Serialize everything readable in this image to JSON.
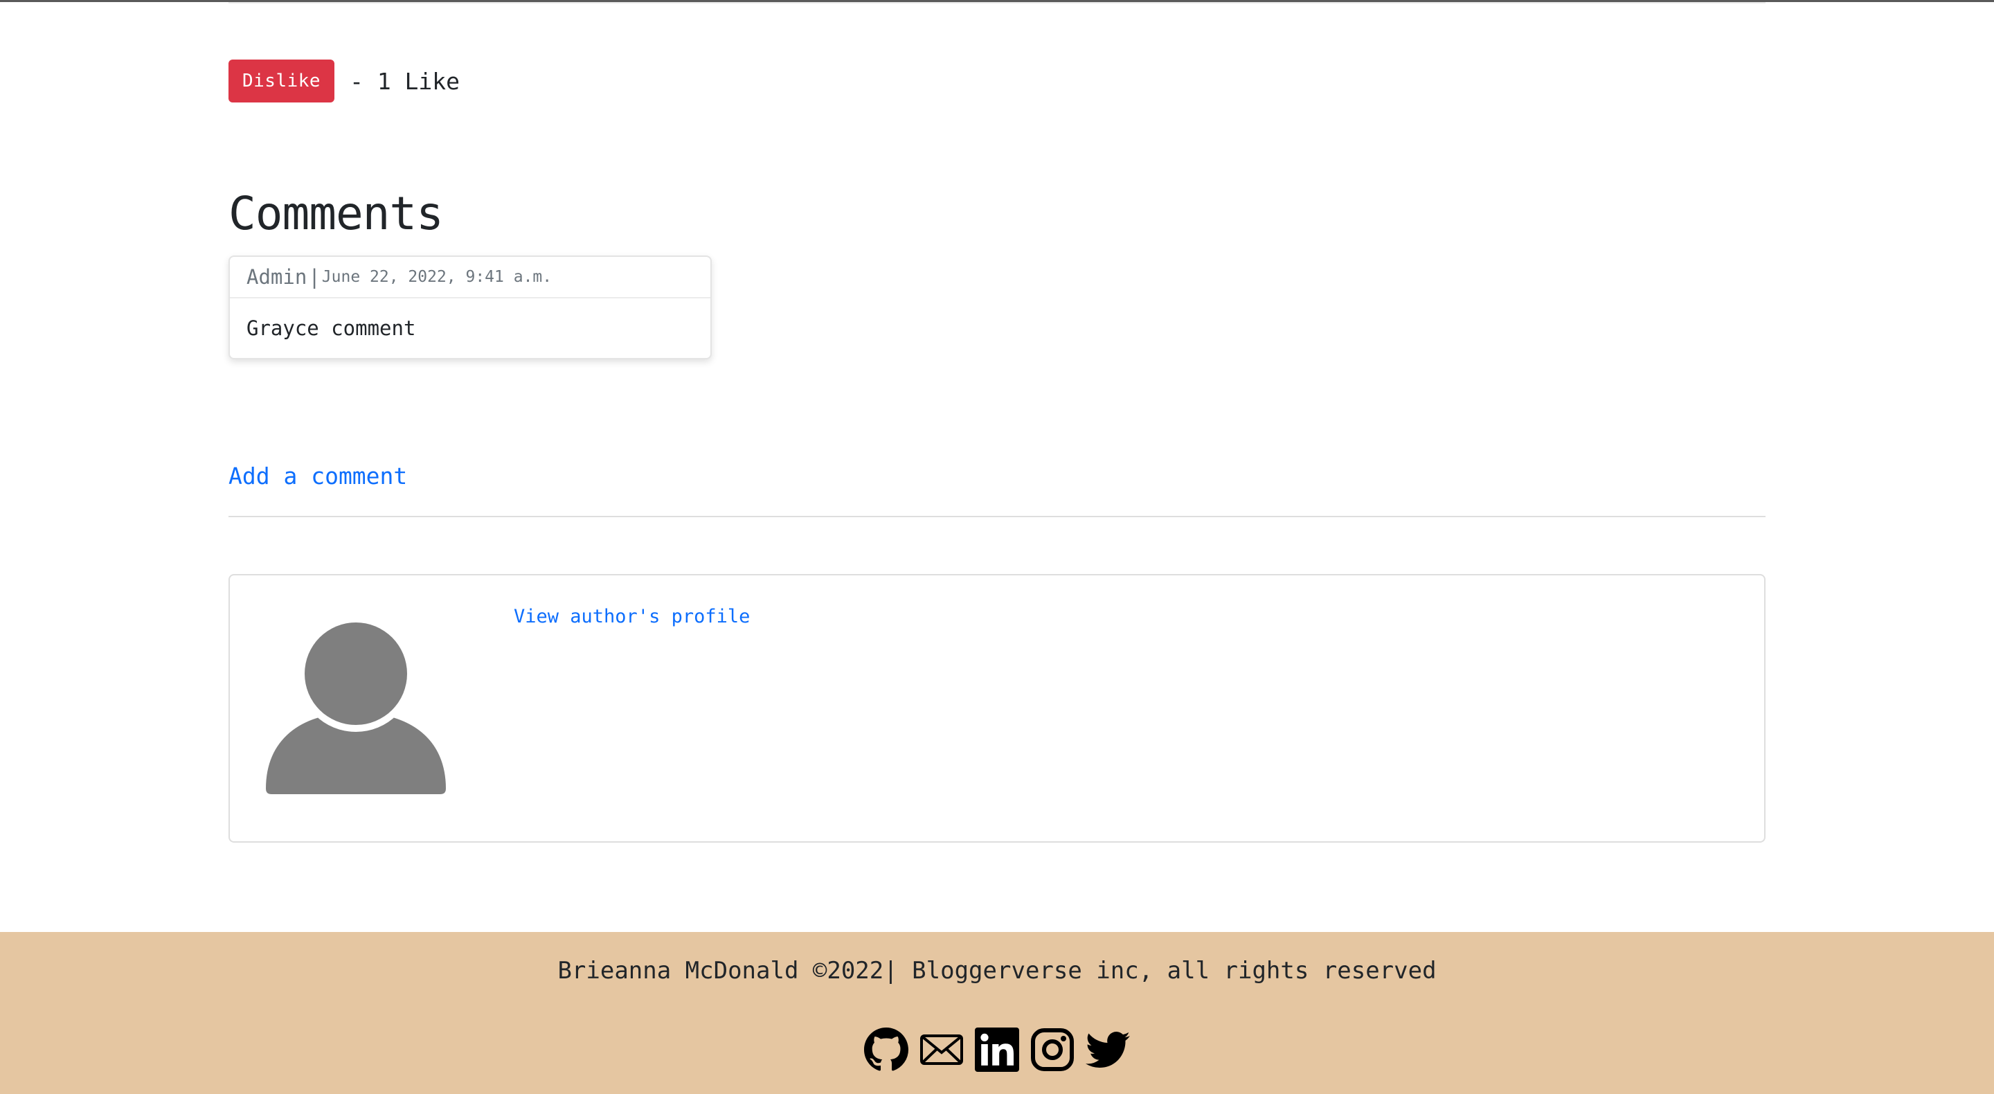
{
  "post": {
    "dislike_label": "Dislike",
    "like_count_text": "- 1 Like"
  },
  "comments": {
    "title": "Comments",
    "items": [
      {
        "author": "Admin",
        "separator": "|",
        "date": "June 22, 2022, 9:41 a.m.",
        "body": "Grayce comment"
      }
    ],
    "add_label": "Add a comment"
  },
  "author_card": {
    "profile_link": "View author's profile",
    "avatar_icon": "user-silhouette-icon"
  },
  "footer": {
    "text": "Brieanna McDonald ©2022| Bloggerverse inc, all rights reserved",
    "social_icons": [
      "github-icon",
      "email-icon",
      "linkedin-icon",
      "instagram-icon",
      "twitter-icon"
    ],
    "background_color": "#e5c6a1"
  },
  "colors": {
    "danger": "#dc3545",
    "link": "#0d6efd",
    "muted": "#6c757d"
  }
}
